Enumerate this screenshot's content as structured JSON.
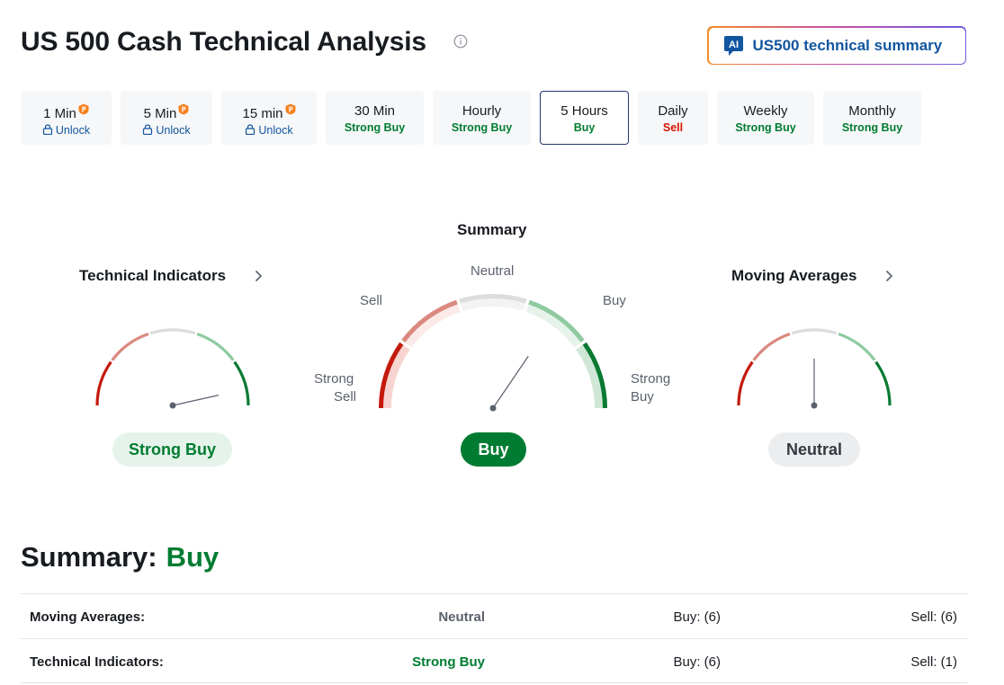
{
  "page": {
    "title": "US 500 Cash Technical Analysis",
    "ai_button_badge": "AI",
    "ai_button_label": "US500 technical summary"
  },
  "timeframes": [
    {
      "name": "1 Min",
      "status": "Unlock",
      "locked": true
    },
    {
      "name": "5 Min",
      "status": "Unlock",
      "locked": true
    },
    {
      "name": "15 min",
      "status": "Unlock",
      "locked": true
    },
    {
      "name": "30 Min",
      "status": "Strong Buy",
      "locked": false
    },
    {
      "name": "Hourly",
      "status": "Strong Buy",
      "locked": false
    },
    {
      "name": "5 Hours",
      "status": "Buy",
      "locked": false,
      "active": true
    },
    {
      "name": "Daily",
      "status": "Sell",
      "locked": false
    },
    {
      "name": "Weekly",
      "status": "Strong Buy",
      "locked": false
    },
    {
      "name": "Monthly",
      "status": "Strong Buy",
      "locked": false
    }
  ],
  "gauges": {
    "summary": {
      "title": "Summary",
      "value": "Buy",
      "labels": {
        "strong_sell_1": "Strong",
        "strong_sell_2": "Sell",
        "sell": "Sell",
        "neutral": "Neutral",
        "buy": "Buy",
        "strong_buy_1": "Strong",
        "strong_buy_2": "Buy"
      },
      "needle_level": 0.69
    },
    "technical_indicators": {
      "title": "Technical Indicators",
      "value": "Strong Buy",
      "needle_level": 0.93
    },
    "moving_averages": {
      "title": "Moving Averages",
      "value": "Neutral",
      "needle_level": 0.5
    }
  },
  "colors": {
    "strong_sell": "#c41a0e",
    "sell": "#d9897f",
    "neutral": "#dddddd",
    "buy": "#8fcaa1",
    "strong_buy": "#0a7a32"
  },
  "summary": {
    "heading": "Summary:",
    "value": "Buy",
    "rows": [
      {
        "label": "Moving Averages:",
        "value": "Neutral",
        "buy": "Buy: (6)",
        "sell": "Sell: (6)"
      },
      {
        "label": "Technical Indicators:",
        "value": "Strong Buy",
        "buy": "Buy: (6)",
        "sell": "Sell: (1)"
      }
    ]
  }
}
